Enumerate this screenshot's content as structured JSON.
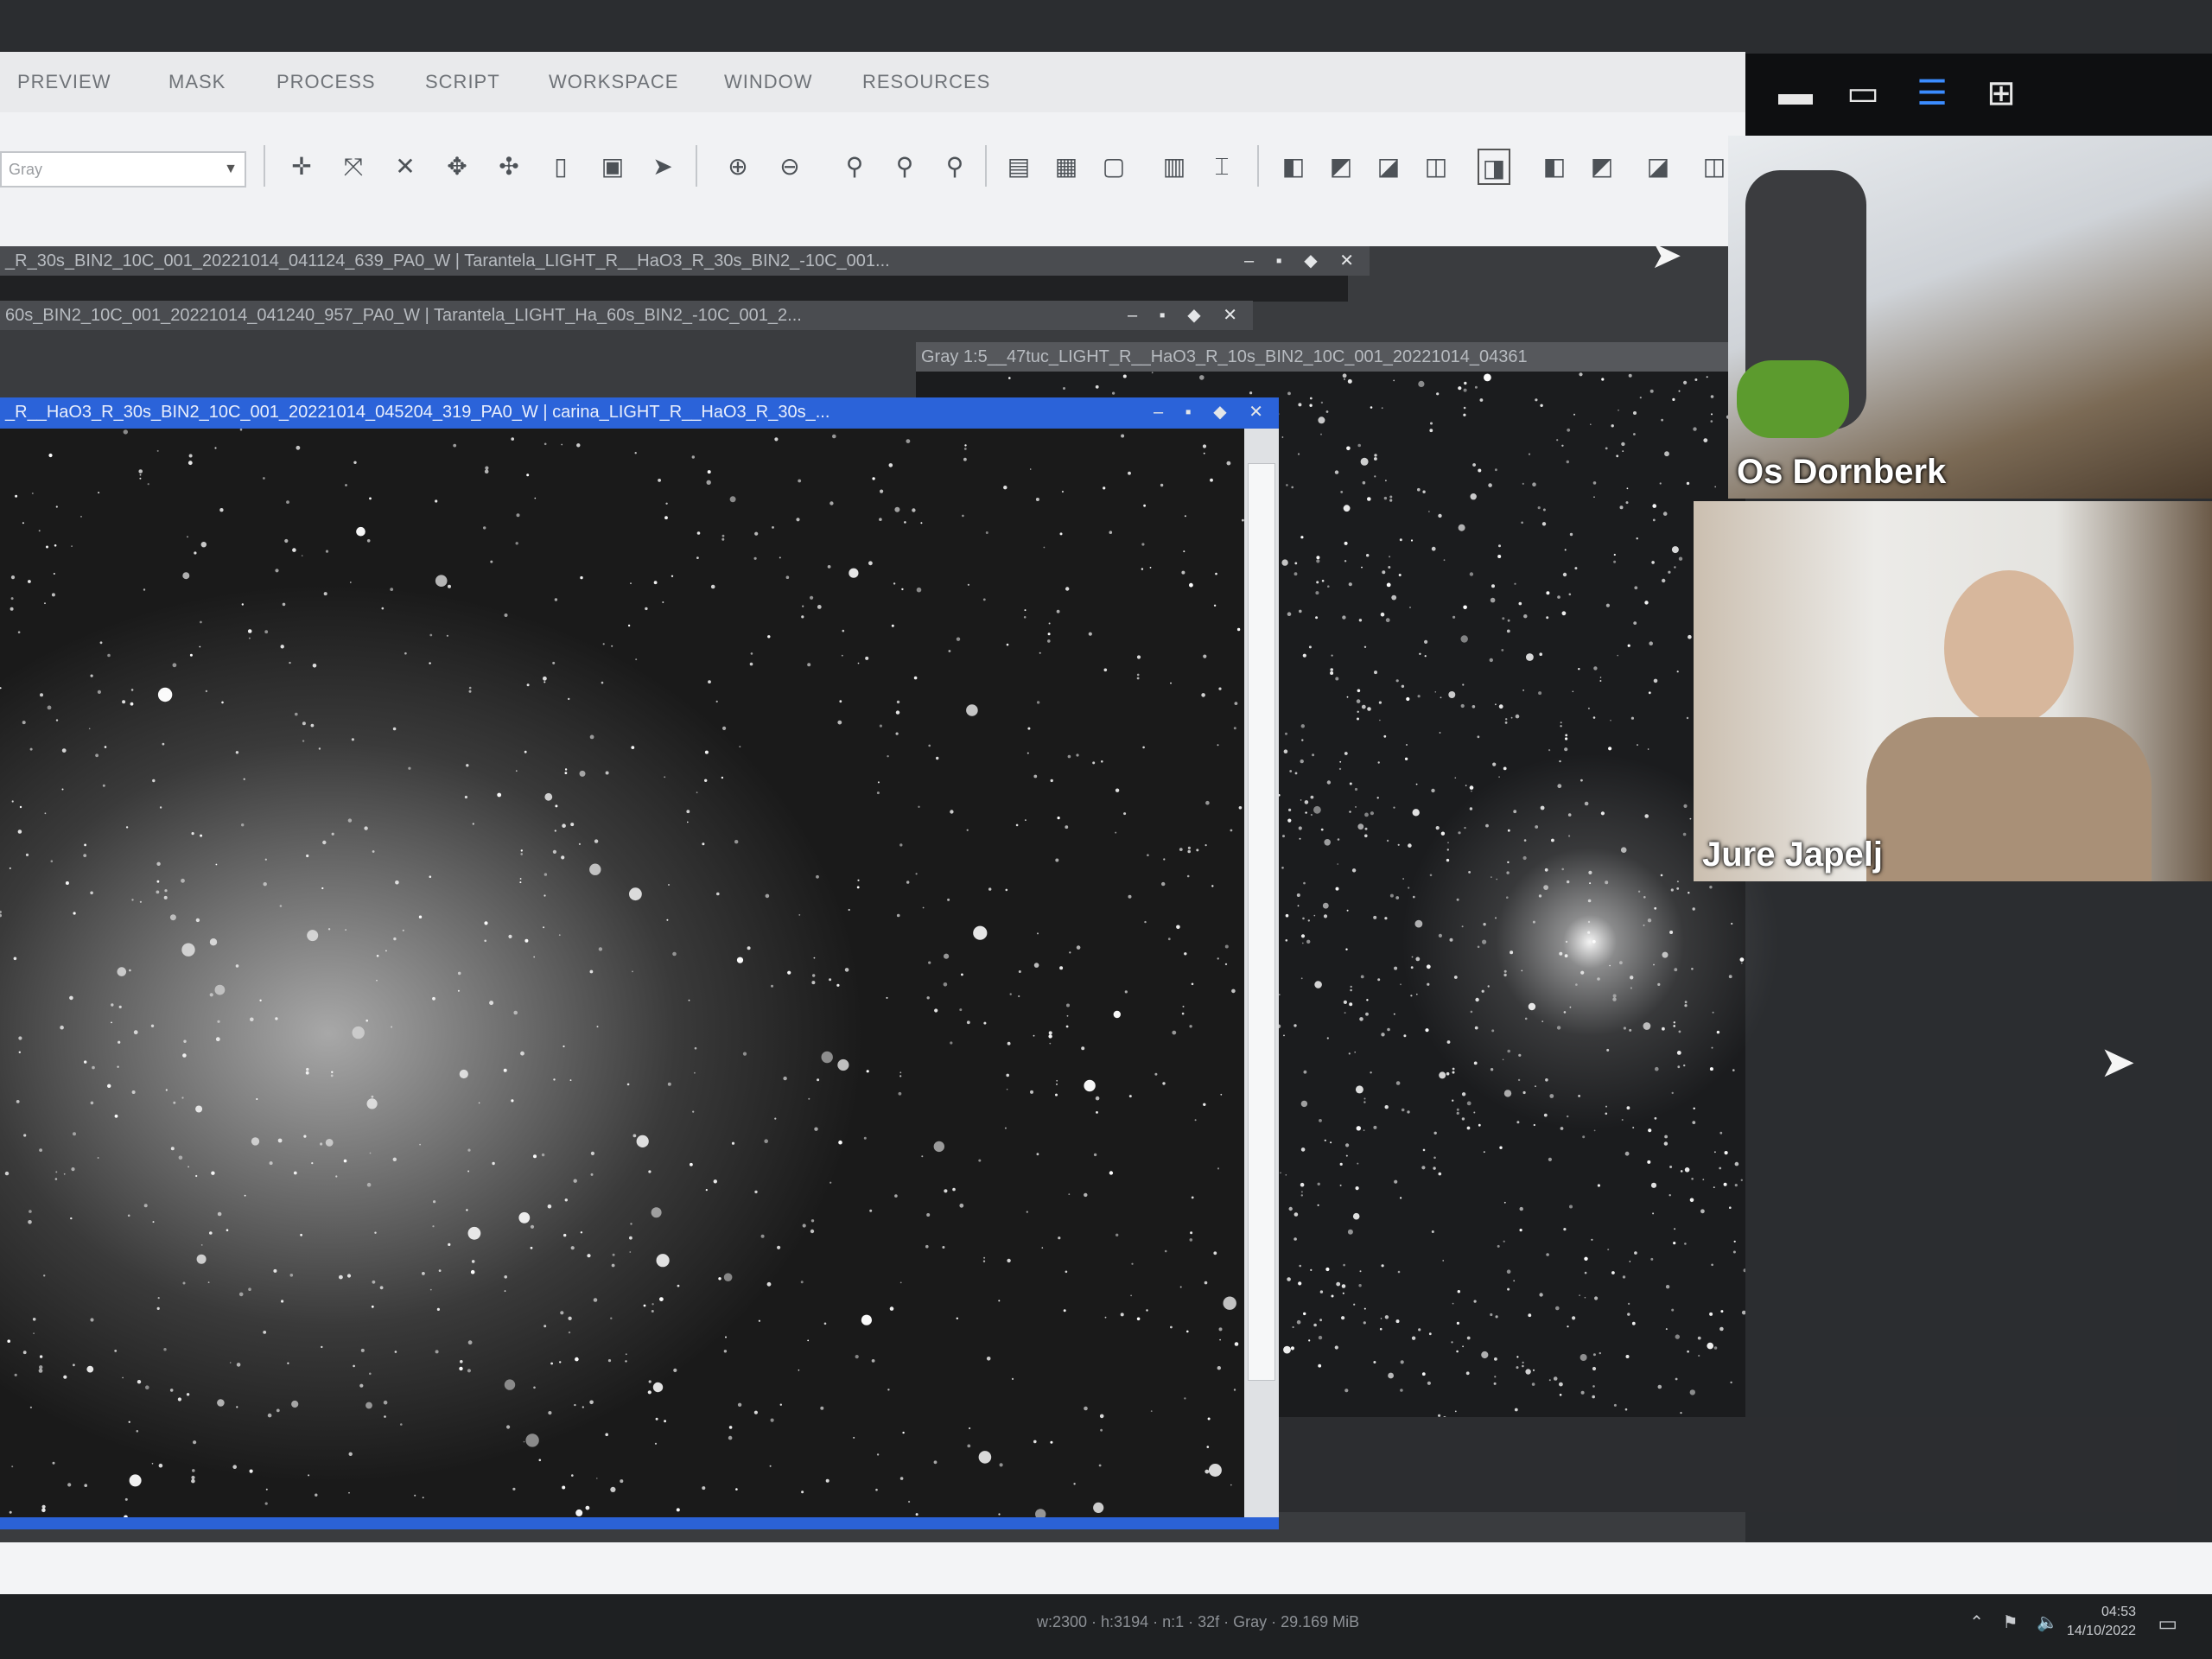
{
  "menu": [
    "PREVIEW",
    "MASK",
    "PROCESS",
    "SCRIPT",
    "WORKSPACE",
    "WINDOW",
    "RESOURCES"
  ],
  "toolbar": {
    "combo_value": "Gray",
    "icons": [
      "move-icon",
      "zoom-fit-icon",
      "zoom-cross-icon",
      "pan-icon",
      "rotate-icon",
      "copy-icon",
      "crop-icon",
      "pointer-icon",
      "zoom-in-icon",
      "zoom-out-icon",
      "zoom-1-icon",
      "zoom-2-icon",
      "zoom-3-icon",
      "view-1-icon",
      "view-2-icon",
      "view-3-icon",
      "view-4-icon",
      "view-5-icon",
      "stf-1-icon",
      "stf-2-icon",
      "stf-3-icon",
      "stf-4-icon",
      "stf-5-icon",
      "stf-6-icon",
      "stf-7-icon",
      "stf-8-icon"
    ]
  },
  "windows": {
    "w1_title": "_R_30s_BIN2_10C_001_20221014_041124_639_PA0_W | Tarantela_LIGHT_R__HaO3_R_30s_BIN2_-10C_001...",
    "w2_title": "60s_BIN2_10C_001_20221014_041240_957_PA0_W | Tarantela_LIGHT_Ha_60s_BIN2_-10C_001_2...",
    "w3_title": "Gray 1:5__47tuc_LIGHT_R__HaO3_R_10s_BIN2_10C_001_20221014_04361",
    "active_title": "_R__HaO3_R_30s_BIN2_10C_001_20221014_045204_319_PA0_W | carina_LIGHT_R__HaO3_R_30s_...",
    "title_buttons": "– ▪ ◆ ✕"
  },
  "status_bar": {
    "text": "w:2300 · h:3194 · n:1 · 32f · Gray · 29.169 MiB",
    "time": "04:53",
    "date": "14/10/2022"
  },
  "meeting": {
    "participants": [
      {
        "name": "Os Dornberk"
      },
      {
        "name": "Jure Japelj"
      }
    ],
    "header_icons": [
      "minimize-icon",
      "stop-video-icon",
      "speaker-view-icon",
      "gallery-view-icon"
    ]
  },
  "colors": {
    "accent": "#2b63d9",
    "meeting_bg": "#0e0f11"
  }
}
